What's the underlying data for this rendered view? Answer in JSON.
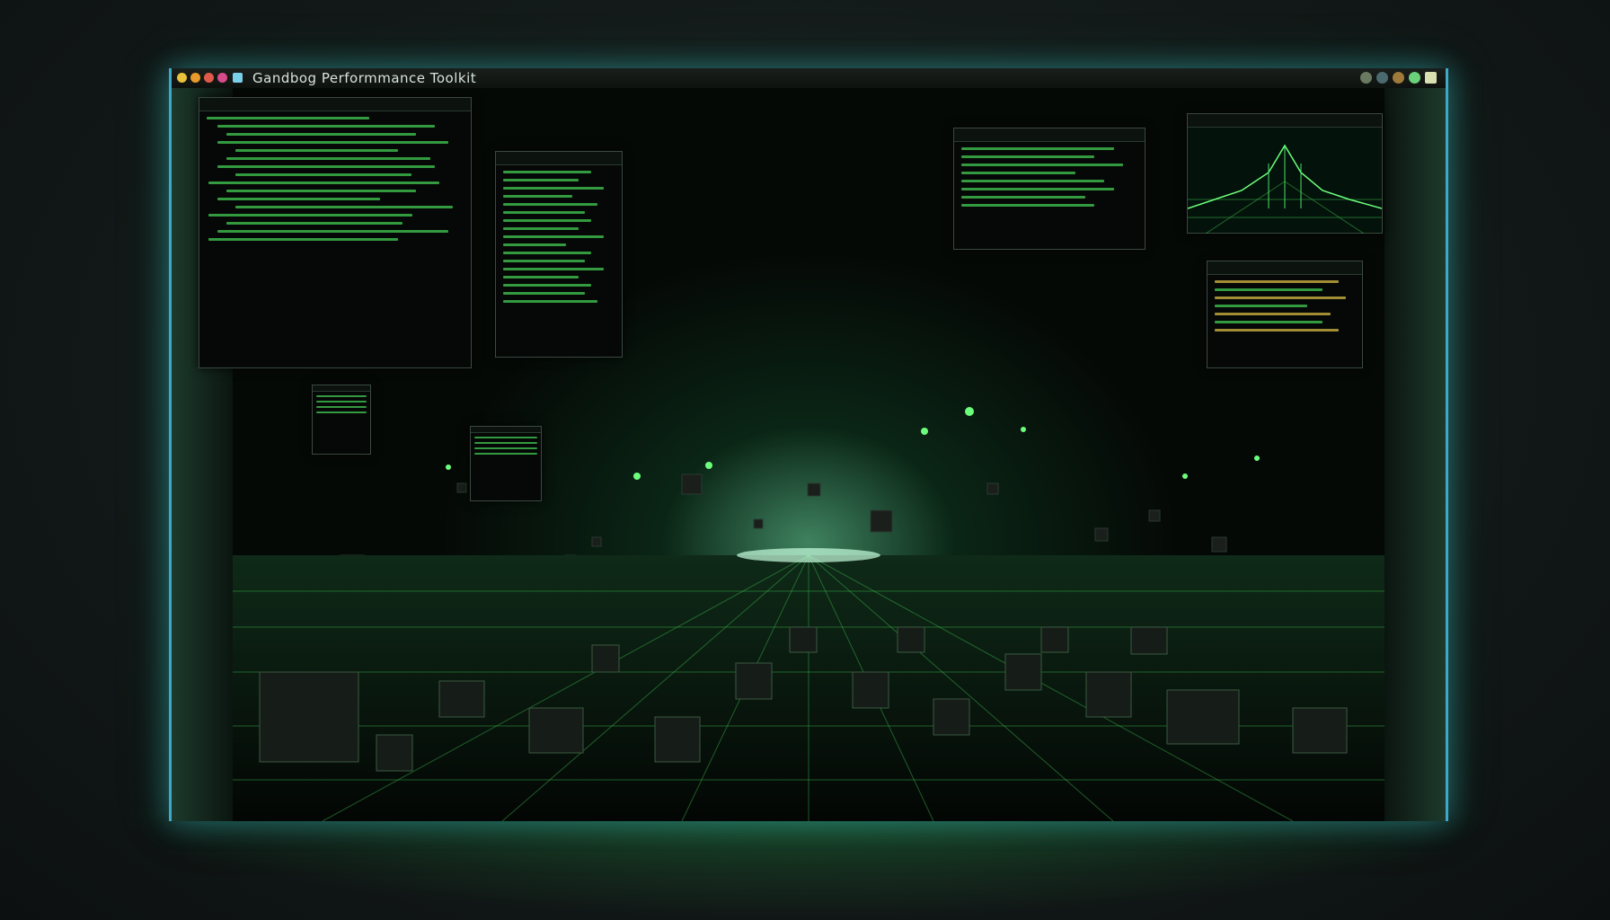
{
  "window": {
    "title": "Gandbog Performmance Toolkit"
  },
  "colors": {
    "accent": "#3fbf4f",
    "frame_edge": "#3fa8c8",
    "background": "#070b09"
  },
  "titlebar_icons": [
    "close-dot",
    "minimize-dot",
    "maximize-dot",
    "info-dot"
  ],
  "titlebar_right_icons": [
    "tool-icon-1",
    "tool-icon-2",
    "tool-icon-3",
    "tool-icon-4",
    "tool-icon-5"
  ],
  "panels": [
    "code-editor",
    "log-list",
    "data-table",
    "chart",
    "code-small",
    "thumb-a",
    "thumb-b"
  ]
}
